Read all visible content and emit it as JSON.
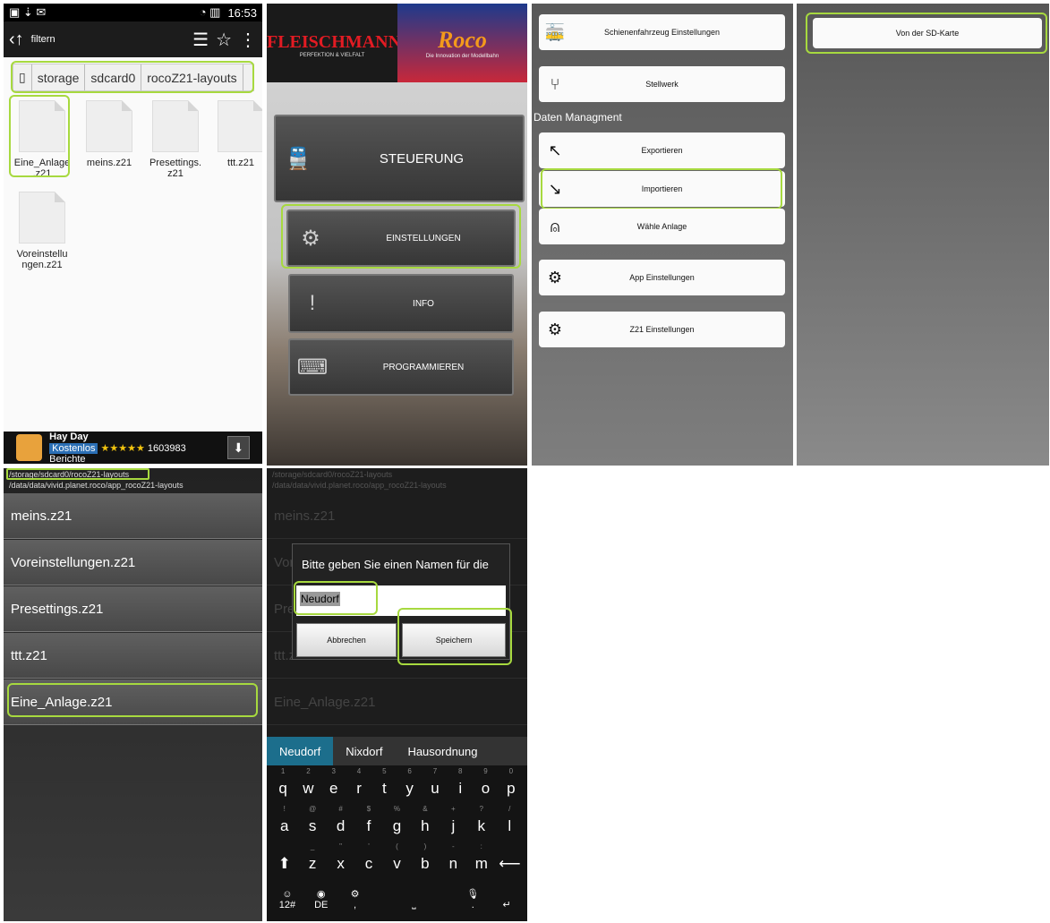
{
  "p1": {
    "time": "16:53",
    "filter_label": "filtern",
    "crumbs": [
      "storage",
      "sdcard0",
      "rocoZ21-layouts"
    ],
    "files": [
      "Eine_Anlage\n.z21",
      "meins.z21",
      "Presettings.\nz21",
      "ttt.z21",
      "Voreinstellu\nngen.z21"
    ],
    "ad": {
      "name": "Hay Day",
      "free": "Kostenlos",
      "stars": "★★★★★",
      "reviews": "1603983 Berichte"
    }
  },
  "p2": {
    "logo_left": "FLEISCHMANN",
    "logo_left_sub": "PERFEKTION & VIELFALT",
    "logo_right": "Roco",
    "logo_right_sub": "Die Innovation der Modellbahn",
    "buttons": [
      "STEUERUNG",
      "EINSTELLUNGEN",
      "INFO",
      "PROGRAMMIEREN"
    ]
  },
  "p3": {
    "btn1": "Schienenfahrzeug Einstellungen",
    "btn2": "Stellwerk",
    "section": "Daten Managment",
    "btn3": "Exportieren",
    "btn4": "Importieren",
    "btn5": "Wähle Anlage",
    "btn6": "App Einstellungen",
    "btn7": "Z21 Einstellungen"
  },
  "p4": {
    "btn": "Von der SD-Karte"
  },
  "p5": {
    "path1": "/storage/sdcard0/rocoZ21-layouts",
    "path2": "/data/data/vivid.planet.roco/app_rocoZ21-layouts",
    "rows": [
      "meins.z21",
      "Voreinstellungen.z21",
      "Presettings.z21",
      "ttt.z21",
      "Eine_Anlage.z21"
    ]
  },
  "p6": {
    "path1": "/storage/sdcard0/rocoZ21-layouts",
    "path2": "/data/data/vivid.planet.roco/app_rocoZ21-layouts",
    "rows": [
      "meins.z21",
      "Vor",
      "Pre",
      "ttt.z21",
      "Eine_Anlage.z21"
    ],
    "dialog_title": "Bitte geben Sie einen Namen für die",
    "input_value": "Neudorf",
    "cancel": "Abbrechen",
    "save": "Speichern",
    "suggestions": [
      "Neudorf",
      "Nixdorf",
      "Hausordnung"
    ]
  },
  "colors": {
    "highlight": "#a7d93f",
    "kb_suggest": "#1c6e8c"
  }
}
